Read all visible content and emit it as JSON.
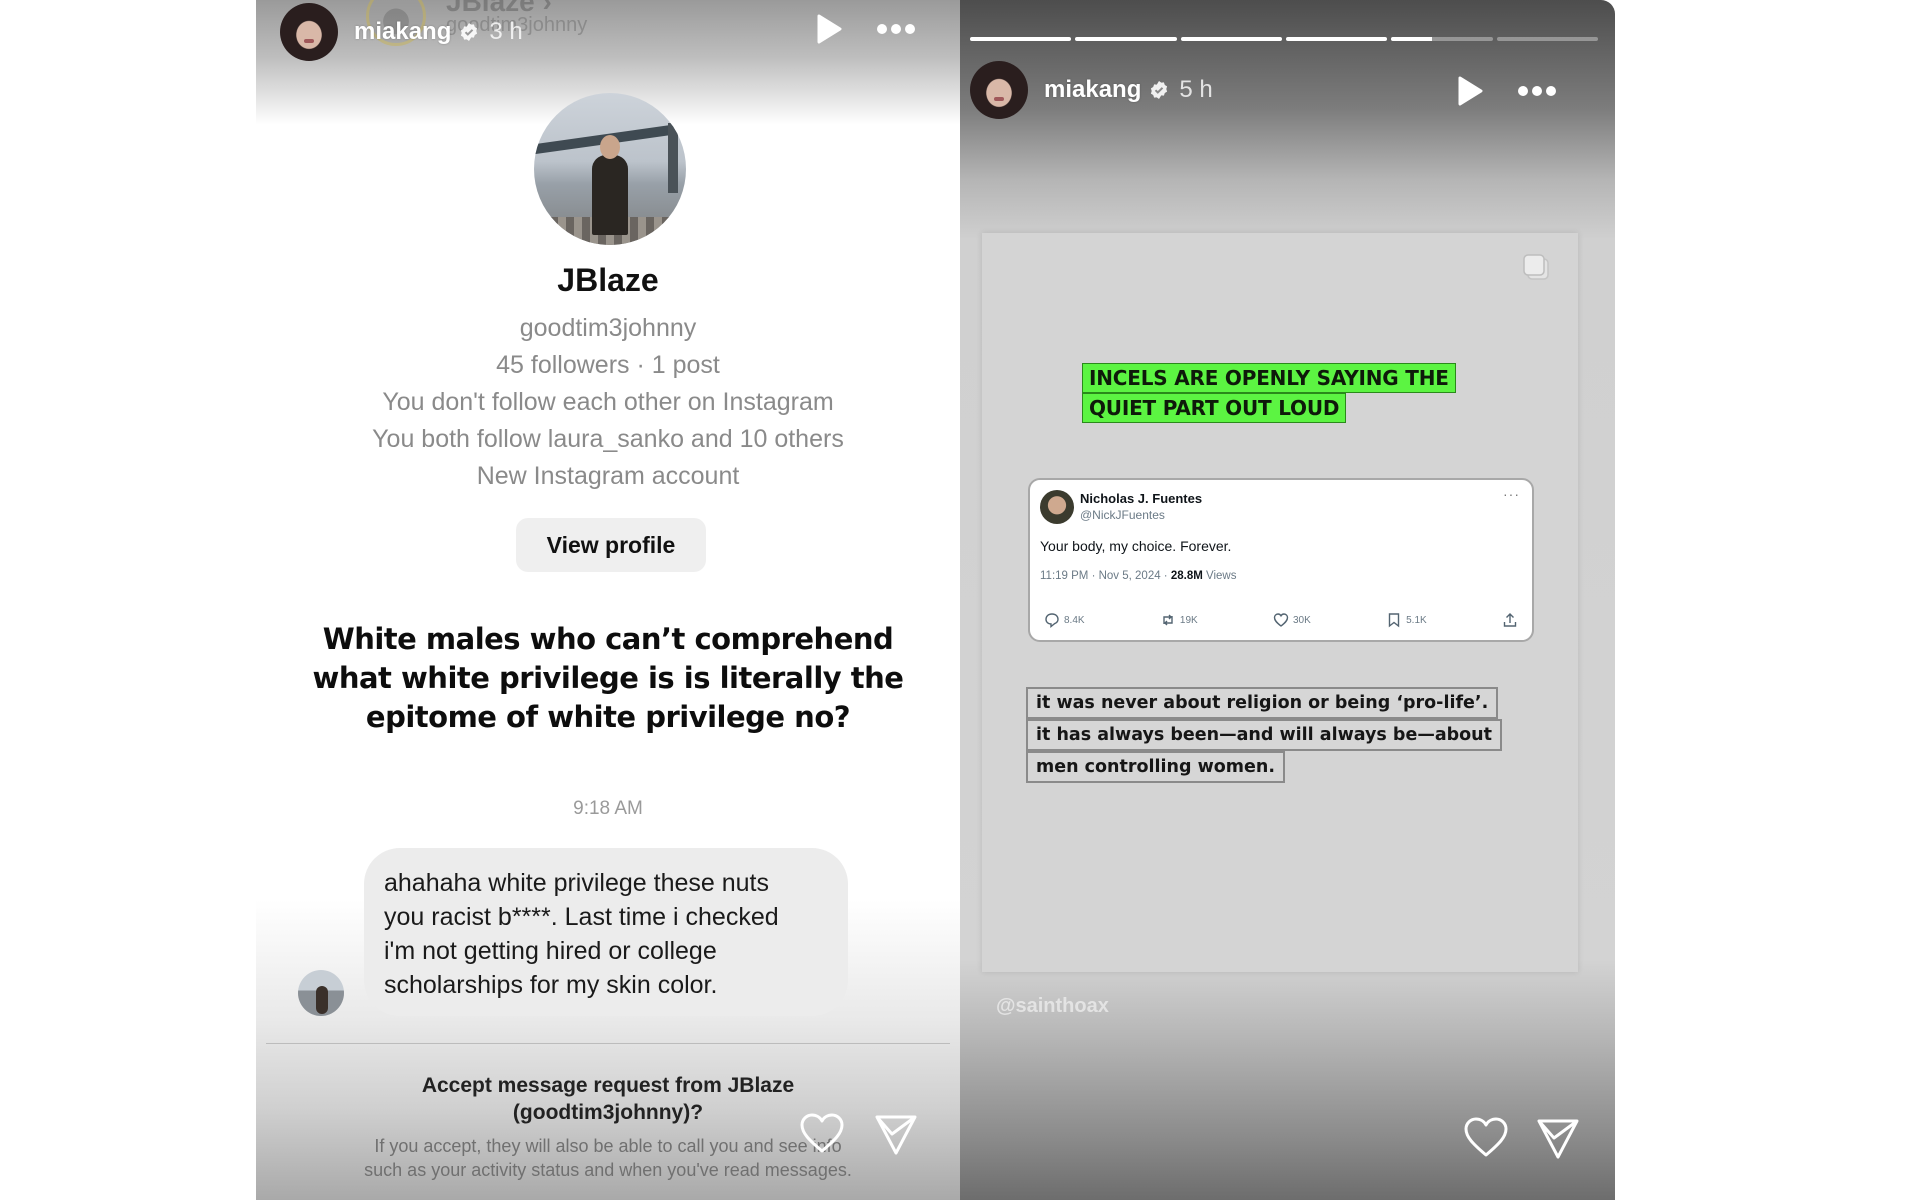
{
  "left_story": {
    "header": {
      "username": "miakang",
      "verified": true,
      "time": "3 h",
      "ghost_name": "JBlaze ›",
      "ghost_handle": "goodtim3johnny"
    },
    "profile": {
      "display_name": "JBlaze",
      "username": "goodtim3johnny",
      "stats": "45 followers · 1 post",
      "follow_status": "You don't follow each other on Instagram",
      "mutuals": "You both follow laura_sanko and 10 others",
      "account_note": "New Instagram account",
      "view_profile_label": "View profile"
    },
    "quote": "White males who can’t comprehend what white privilege is is literally the epitome of white privilege no?",
    "message_time": "9:18 AM",
    "message_lines": [
      "ahahaha white privilege these nuts",
      "you racist b****. Last time i checked",
      "i'm not getting hired or college",
      "scholarships for my skin color."
    ],
    "request": {
      "title_line1": "Accept message request from JBlaze",
      "title_line2": "(goodtim3johnny)?",
      "note_line1": "If you accept, they will also be able to call you and see info",
      "note_line2": "such as your activity status and when you've read messages."
    },
    "icons": {
      "play": "play-icon",
      "more": "more-icon",
      "like": "heart-icon",
      "share": "send-icon"
    }
  },
  "right_story": {
    "progress": [
      1,
      1,
      1,
      1,
      0.4,
      0
    ],
    "header": {
      "username": "miakang",
      "verified": true,
      "time": "5 h"
    },
    "post": {
      "headline_line1": "INCELS ARE OPENLY SAYING THE",
      "headline_line2": "QUIET PART OUT LOUD",
      "headline_color": "#5cf442",
      "tweet": {
        "name": "Nicholas J. Fuentes",
        "handle": "@NickJFuentes",
        "more": "···",
        "body": "Your body, my choice. Forever.",
        "meta_time": "11:19 PM · Nov 5, 2024 · ",
        "views_count": "28.8M",
        "views_label": " Views",
        "replies": "8.4K",
        "reposts": "19K",
        "likes": "30K",
        "bookmarks": "5.1K"
      },
      "caption_line1": "it was never about religion or being ‘pro-life’.",
      "caption_line2": "it has always been—and will always be—about",
      "caption_line3": "men controlling women."
    },
    "watermark": "@sainthoax"
  }
}
